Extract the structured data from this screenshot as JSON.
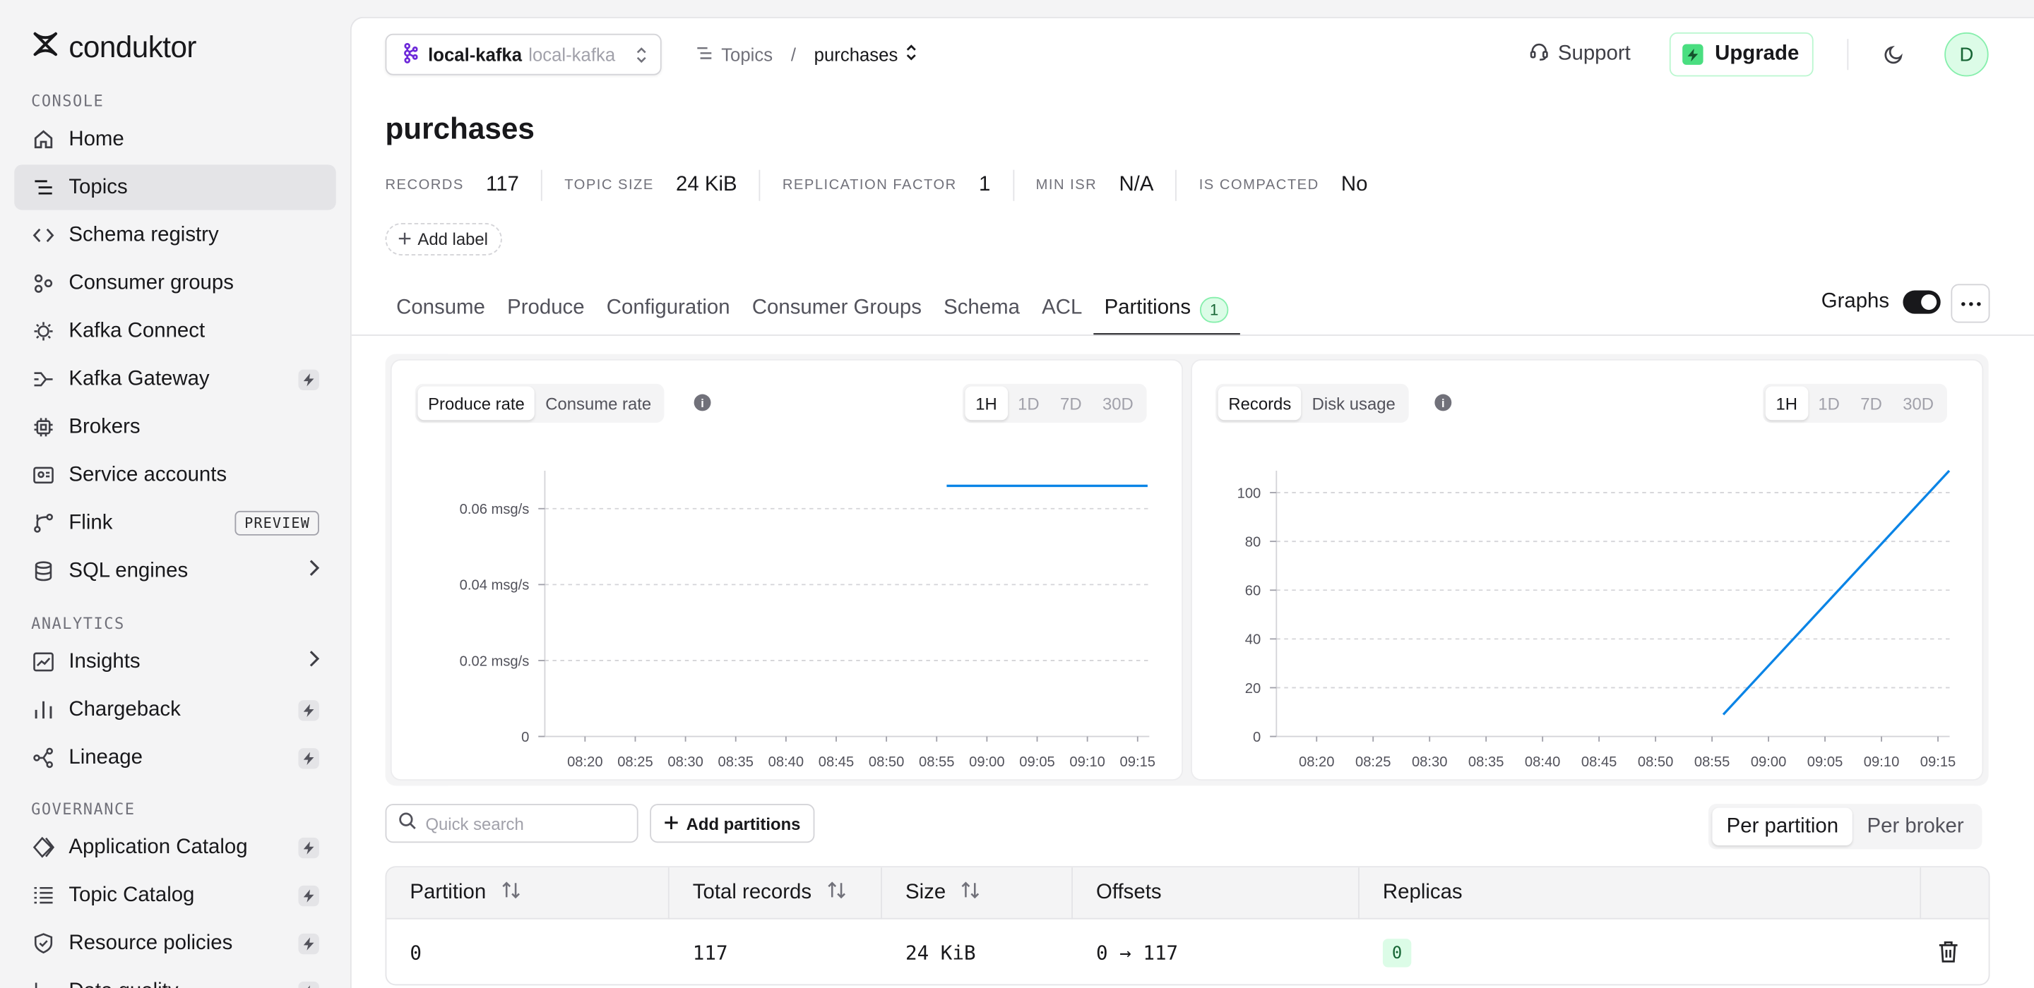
{
  "brand": {
    "name": "conduktor"
  },
  "sidebar": {
    "sections": [
      {
        "label": "CONSOLE",
        "items": [
          {
            "label": "Home",
            "icon": "home-icon"
          },
          {
            "label": "Topics",
            "icon": "topics-icon",
            "active": true
          },
          {
            "label": "Schema registry",
            "icon": "code-icon"
          },
          {
            "label": "Consumer groups",
            "icon": "consumer-groups-icon"
          },
          {
            "label": "Kafka Connect",
            "icon": "connect-icon"
          },
          {
            "label": "Kafka Gateway",
            "icon": "gateway-icon",
            "bolt": true
          },
          {
            "label": "Brokers",
            "icon": "chip-icon"
          },
          {
            "label": "Service accounts",
            "icon": "id-card-icon"
          },
          {
            "label": "Flink",
            "icon": "flink-icon",
            "badge": "PREVIEW"
          },
          {
            "label": "SQL engines",
            "icon": "database-icon",
            "chevron": true
          }
        ]
      },
      {
        "label": "ANALYTICS",
        "items": [
          {
            "label": "Insights",
            "icon": "insights-icon",
            "chevron": true
          },
          {
            "label": "Chargeback",
            "icon": "bar-chart-icon",
            "bolt": true
          },
          {
            "label": "Lineage",
            "icon": "lineage-icon",
            "bolt": true
          }
        ]
      },
      {
        "label": "GOVERNANCE",
        "items": [
          {
            "label": "Application Catalog",
            "icon": "catalog-icon",
            "bolt": true
          },
          {
            "label": "Topic Catalog",
            "icon": "list-icon",
            "bolt": true
          },
          {
            "label": "Resource policies",
            "icon": "shield-icon",
            "bolt": true
          },
          {
            "label": "Data quality",
            "icon": "data-quality-icon",
            "bolt": true
          }
        ]
      }
    ]
  },
  "header": {
    "cluster_name": "local-kafka",
    "cluster_id": "local-kafka",
    "breadcrumb_parent": "Topics",
    "breadcrumb_sep": "/",
    "breadcrumb_current": "purchases",
    "support": "Support",
    "upgrade": "Upgrade",
    "avatar": "D"
  },
  "topic": {
    "title": "purchases",
    "stats": [
      {
        "key": "RECORDS",
        "value": "117"
      },
      {
        "key": "TOPIC SIZE",
        "value": "24 KiB"
      },
      {
        "key": "REPLICATION FACTOR",
        "value": "1"
      },
      {
        "key": "MIN ISR",
        "value": "N/A"
      },
      {
        "key": "IS COMPACTED",
        "value": "No"
      }
    ],
    "add_label": "Add label"
  },
  "tabs": [
    {
      "label": "Consume"
    },
    {
      "label": "Produce"
    },
    {
      "label": "Configuration"
    },
    {
      "label": "Consumer Groups"
    },
    {
      "label": "Schema"
    },
    {
      "label": "ACL"
    },
    {
      "label": "Partitions",
      "count": "1",
      "active": true
    }
  ],
  "graphs_toggle": {
    "label": "Graphs",
    "on": true
  },
  "charts": {
    "left": {
      "options": [
        "Produce rate",
        "Consume rate"
      ],
      "selected": "Produce rate",
      "ranges": [
        "1H",
        "1D",
        "7D",
        "30D"
      ],
      "selected_range": "1H"
    },
    "right": {
      "options": [
        "Records",
        "Disk usage"
      ],
      "selected": "Records",
      "ranges": [
        "1H",
        "1D",
        "7D",
        "30D"
      ],
      "selected_range": "1H"
    }
  },
  "chart_data": [
    {
      "type": "line",
      "x": [
        "08:20",
        "08:25",
        "08:30",
        "08:35",
        "08:40",
        "08:45",
        "08:50",
        "08:55",
        "09:00",
        "09:05",
        "09:10",
        "09:15"
      ],
      "yticks": [
        0,
        0.02,
        0.04,
        0.06
      ],
      "ytick_labels": [
        "0",
        "0.02 msg/s",
        "0.04 msg/s",
        "0.06 msg/s"
      ],
      "ylim": [
        0,
        0.07
      ],
      "grid": true,
      "series": [
        {
          "points": [
            {
              "x": "08:56",
              "y": 0.066
            },
            {
              "x": "09:16",
              "y": 0.066
            }
          ]
        }
      ]
    },
    {
      "type": "line",
      "x": [
        "08:20",
        "08:25",
        "08:30",
        "08:35",
        "08:40",
        "08:45",
        "08:50",
        "08:55",
        "09:00",
        "09:05",
        "09:10",
        "09:15"
      ],
      "yticks": [
        0,
        20,
        40,
        60,
        80,
        100
      ],
      "ytick_labels": [
        "0",
        "20",
        "40",
        "60",
        "80",
        "100"
      ],
      "ylim": [
        0,
        109
      ],
      "grid": true,
      "series": [
        {
          "points": [
            {
              "x": "08:56",
              "y": 9
            },
            {
              "x": "09:16",
              "y": 109
            }
          ]
        }
      ]
    }
  ],
  "partitions": {
    "search_placeholder": "Quick search",
    "add_button": "Add partitions",
    "view_options": [
      "Per partition",
      "Per broker"
    ],
    "view_selected": "Per partition",
    "columns": [
      "Partition",
      "Total records",
      "Size",
      "Offsets",
      "Replicas"
    ],
    "rows": [
      {
        "partition": "0",
        "total_records": "117",
        "size": "24 KiB",
        "offsets": "0 → 117",
        "replicas": "0"
      }
    ]
  }
}
